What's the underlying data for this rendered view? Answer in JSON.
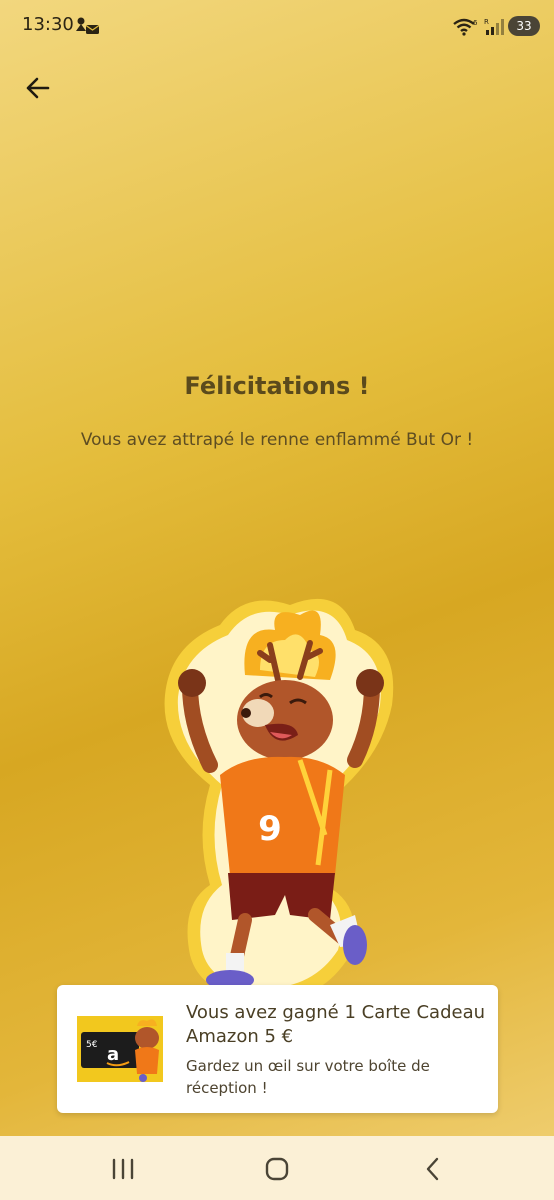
{
  "status_bar": {
    "time": "13:30",
    "battery": "33",
    "icons": [
      "notification-icons",
      "wifi-icon",
      "signal-icon",
      "battery-icon"
    ]
  },
  "header": {
    "back_icon": "arrow-left-icon"
  },
  "main": {
    "title": "Félicitations !",
    "subtitle": "Vous avez attrapé le renne enflammé But Or !",
    "mascot_jersey_number": "9"
  },
  "reward": {
    "title": "Vous avez gagné 1 Carte Cadeau Amazon 5 €",
    "subtitle": "Gardez un œil sur votre boîte de réception !",
    "card_amount": "5€",
    "card_brand": "a"
  },
  "nav_bar": {
    "icons": [
      "recent-apps-icon",
      "home-icon",
      "back-nav-icon"
    ]
  },
  "colors": {
    "background_gold": "#d7a722",
    "title_text": "#5b4a1c",
    "card_bg": "#ffffff",
    "nav_bg": "#fbf0d6"
  }
}
